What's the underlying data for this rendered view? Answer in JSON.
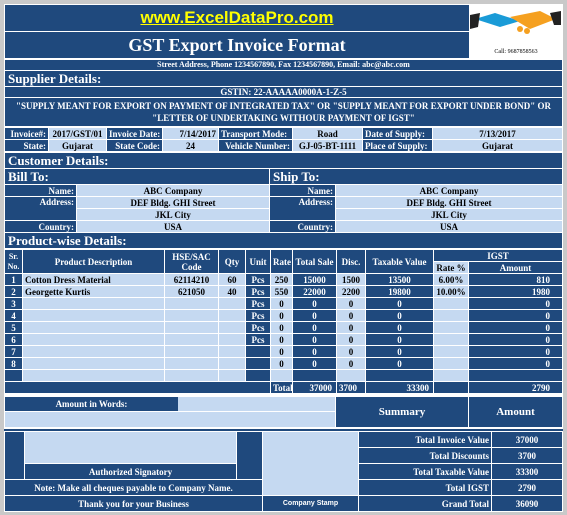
{
  "header": {
    "website": "www.ExcelDataPro.com",
    "title": "GST Export Invoice Format",
    "address": "Street Address, Phone 1234567890, Fax 1234567890, Email: abc@abc.com",
    "logo_text": "Call: 9687858563"
  },
  "supplier": {
    "heading": "Supplier Details:",
    "gstin": "GSTIN: 22-AAAAA0000A-1-Z-5",
    "declaration": "\"SUPPLY MEANT FOR EXPORT ON PAYMENT OF INTEGRATED TAX\" OR \"SUPPLY MEANT FOR EXPORT UNDER BOND\" OR \"LETTER OF UNDERTAKING WITHOUR PAYMENT OF IGST\"",
    "invoice_no_label": "Invoice#:",
    "invoice_no": "2017/GST/01",
    "invoice_date_label": "Invoice Date:",
    "invoice_date": "7/14/2017",
    "transport_label": "Transport Mode:",
    "transport": "Road",
    "supply_date_label": "Date of Supply:",
    "supply_date": "7/13/2017",
    "state_label": "State:",
    "state": "Gujarat",
    "state_code_label": "State Code:",
    "state_code": "24",
    "vehicle_label": "Vehicle Number:",
    "vehicle": "GJ-05-BT-1111",
    "place_label": "Place of Supply:",
    "place": "Gujarat"
  },
  "customer": {
    "heading": "Customer Details:",
    "bill_to": "Bill To:",
    "ship_to": "Ship To:",
    "name_label": "Name:",
    "address_label": "Address:",
    "country_label": "Country:",
    "bill": {
      "name": "ABC Company",
      "address1": "DEF Bldg. GHI Street",
      "address2": "JKL City",
      "country": "USA"
    },
    "ship": {
      "name": "ABC Company",
      "address1": "DEF Bldg. GHI Street",
      "address2": "JKL City",
      "country": "USA"
    }
  },
  "products": {
    "heading": "Product-wise Details:",
    "columns": {
      "sr": "Sr. No.",
      "desc": "Product Description",
      "code": "HSE/SAC Code",
      "qty": "Qty",
      "unit": "Unit",
      "rate": "Rate",
      "total": "Total Sale",
      "disc": "Disc.",
      "taxable": "Taxable Value",
      "igst": "IGST",
      "igst_rate": "Rate %",
      "igst_amount": "Amount"
    },
    "rows": [
      {
        "sr": "1",
        "desc": "Cotton Dress Material",
        "code": "62114210",
        "qty": "60",
        "unit": "Pcs",
        "rate": "250",
        "total": "15000",
        "disc": "1500",
        "taxable": "13500",
        "igst_rate": "6.00%",
        "igst_amount": "810"
      },
      {
        "sr": "2",
        "desc": "Georgette Kurtis",
        "code": "621050",
        "qty": "40",
        "unit": "Pcs",
        "rate": "550",
        "total": "22000",
        "disc": "2200",
        "taxable": "19800",
        "igst_rate": "10.00%",
        "igst_amount": "1980"
      },
      {
        "sr": "3",
        "desc": "",
        "code": "",
        "qty": "",
        "unit": "Pcs",
        "rate": "0",
        "total": "0",
        "disc": "0",
        "taxable": "0",
        "igst_rate": "",
        "igst_amount": "0"
      },
      {
        "sr": "4",
        "desc": "",
        "code": "",
        "qty": "",
        "unit": "Pcs",
        "rate": "0",
        "total": "0",
        "disc": "0",
        "taxable": "0",
        "igst_rate": "",
        "igst_amount": "0"
      },
      {
        "sr": "5",
        "desc": "",
        "code": "",
        "qty": "",
        "unit": "Pcs",
        "rate": "0",
        "total": "0",
        "disc": "0",
        "taxable": "0",
        "igst_rate": "",
        "igst_amount": "0"
      },
      {
        "sr": "6",
        "desc": "",
        "code": "",
        "qty": "",
        "unit": "Pcs",
        "rate": "0",
        "total": "0",
        "disc": "0",
        "taxable": "0",
        "igst_rate": "",
        "igst_amount": "0"
      },
      {
        "sr": "7",
        "desc": "",
        "code": "",
        "qty": "",
        "unit": "",
        "rate": "0",
        "total": "0",
        "disc": "0",
        "taxable": "0",
        "igst_rate": "",
        "igst_amount": "0"
      },
      {
        "sr": "8",
        "desc": "",
        "code": "",
        "qty": "",
        "unit": "",
        "rate": "0",
        "total": "0",
        "disc": "0",
        "taxable": "0",
        "igst_rate": "",
        "igst_amount": "0"
      },
      {
        "sr": "",
        "desc": "",
        "code": "",
        "qty": "",
        "unit": "",
        "rate": "",
        "total": "",
        "disc": "",
        "taxable": "",
        "igst_rate": "",
        "igst_amount": ""
      }
    ],
    "totals": {
      "label": "Total",
      "total": "37000",
      "disc": "3700",
      "taxable": "33300",
      "igst_amount": "2790"
    }
  },
  "footer": {
    "amount_words_label": "Amount in Words:",
    "signatory": "Authorized Signatory",
    "note": "Note: Make all cheques payable to Company Name.",
    "thanks": "Thank you for your Business",
    "stamp": "Company Stamp"
  },
  "summary": {
    "heading": "Summary",
    "amount_heading": "Amount",
    "items": [
      {
        "label": "Total Invoice Value",
        "value": "37000"
      },
      {
        "label": "Total Discounts",
        "value": "3700"
      },
      {
        "label": "Total Taxable Value",
        "value": "33300"
      },
      {
        "label": "Total IGST",
        "value": "2790"
      },
      {
        "label": "Grand Total",
        "value": "36090"
      }
    ]
  },
  "colors": {
    "dark": "#1f497d",
    "light": "#c5d9f1",
    "link": "#ffff00"
  }
}
